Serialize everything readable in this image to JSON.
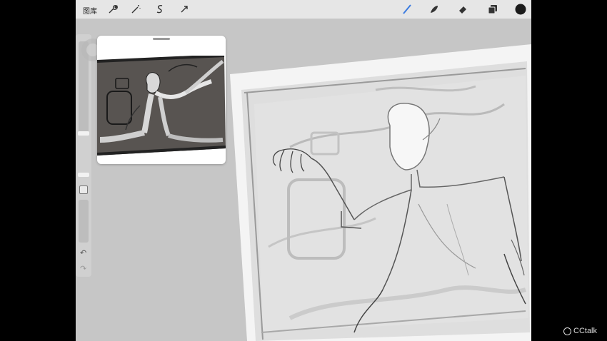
{
  "topbar": {
    "gallery_label": "图库",
    "left_icons": [
      "wrench-icon",
      "magic-wand-icon",
      "selection-icon",
      "transform-arrow-icon"
    ],
    "right_icons": [
      "brush-icon",
      "smudge-icon",
      "eraser-icon",
      "layers-icon",
      "color-swatch-icon"
    ],
    "active_color": "#1a1a1a",
    "brush_accent": "#3b7be0"
  },
  "sidebar": {
    "icons": [
      "modifier-square-icon",
      "undo-icon",
      "redo-icon"
    ],
    "undo_glyph": "↶",
    "redo_glyph": "↷"
  },
  "reference_window": {
    "handle": "drag-handle"
  },
  "watermark": {
    "label": "CCtalk"
  }
}
